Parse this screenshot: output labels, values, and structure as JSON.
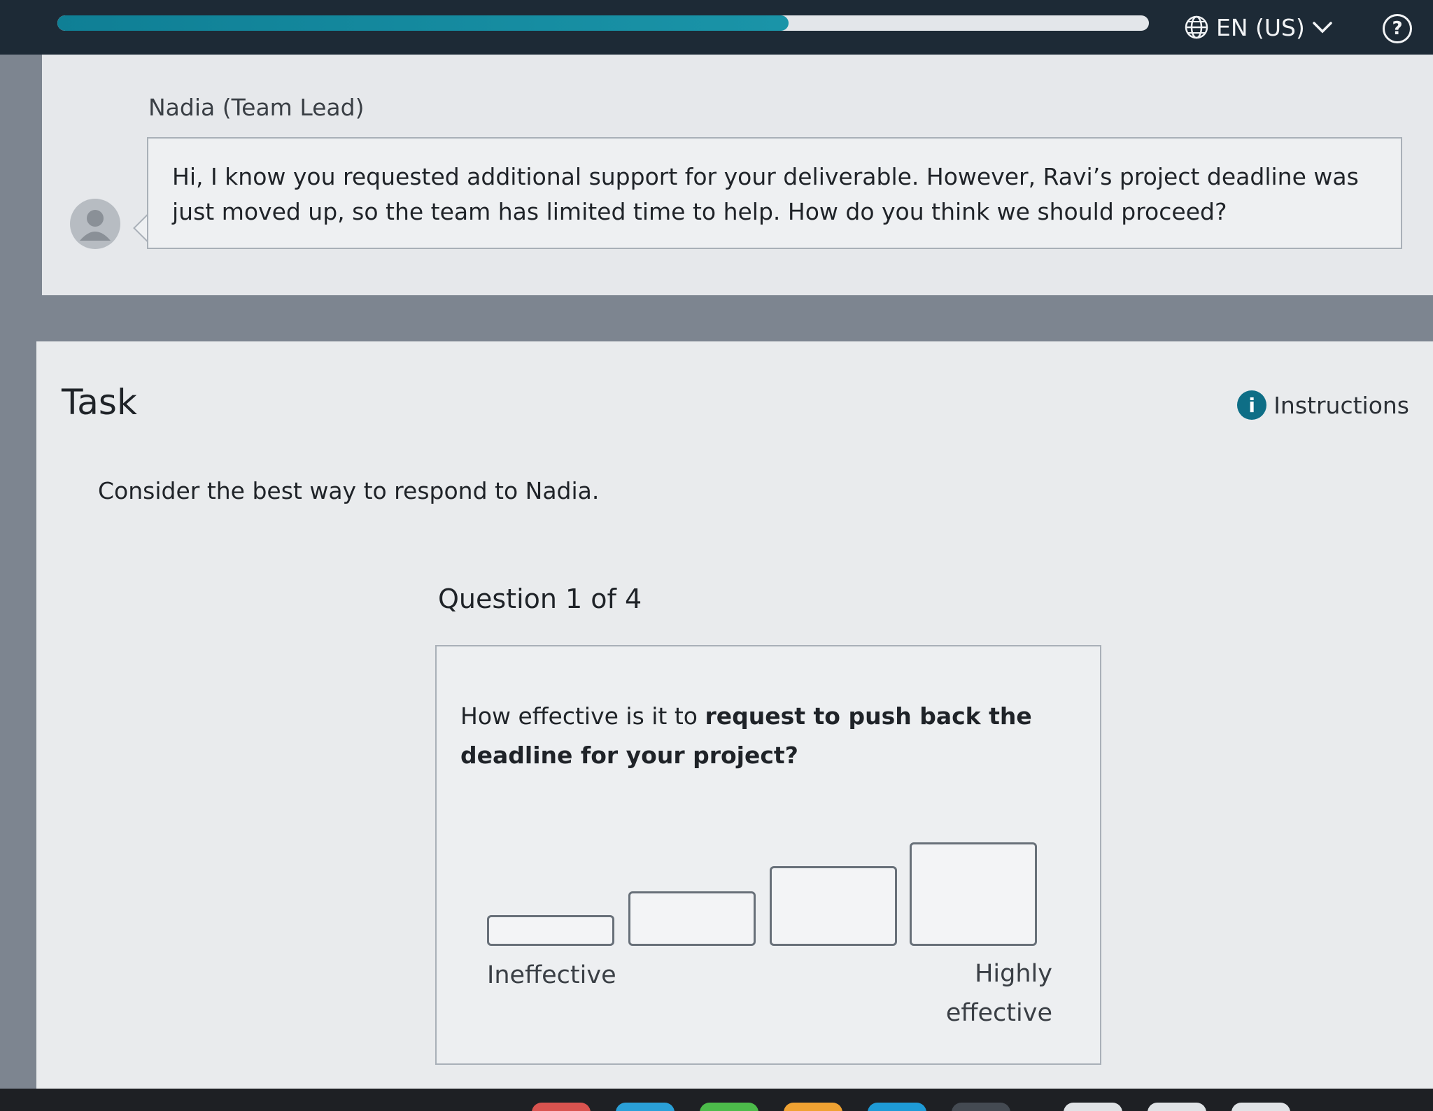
{
  "header": {
    "progress_percent": 67,
    "language_label": "EN (US)",
    "help_label": "?"
  },
  "message": {
    "sender": "Nadia (Team Lead)",
    "body": "Hi, I know you requested additional support for your deliverable. However, Ravi’s project deadline was just moved up, so the team has limited time to help. How do you think we should proceed?"
  },
  "task": {
    "title": "Task",
    "instructions_label": "Instructions",
    "prompt": "Consider the best way to respond to Nadia.",
    "question_counter": "Question 1 of 4",
    "question": {
      "prefix": "How effective is it to ",
      "bold": "request to push back the deadline for your project?"
    },
    "scale": {
      "options": 4,
      "low_label": "Ineffective",
      "high_label": "Highly effective"
    }
  },
  "colors": {
    "topbar": "#1d2a36",
    "accent": "#0f7f95",
    "info": "#0e6e86"
  },
  "icons": {
    "language": "globe-icon",
    "dropdown": "chevron-down-icon",
    "help": "question-circle-icon",
    "instructions": "info-icon",
    "avatar": "user-silhouette-icon"
  }
}
